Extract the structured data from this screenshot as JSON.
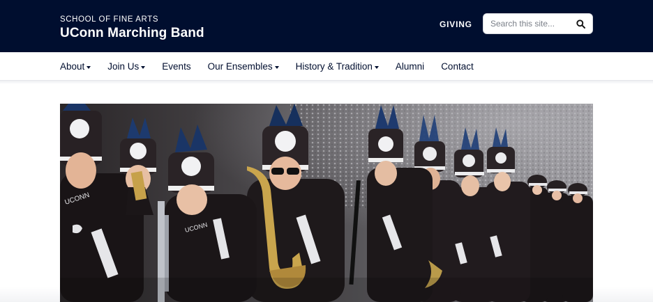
{
  "header": {
    "eyebrow": "SCHOOL OF FINE ARTS",
    "title": "UConn Marching Band",
    "giving_label": "GIVING",
    "search_placeholder": "Search this site...",
    "search_icon": "magnifier-icon",
    "background_color": "#000e2f"
  },
  "nav": {
    "items": [
      {
        "label": "About",
        "dropdown": true
      },
      {
        "label": "Join Us",
        "dropdown": true
      },
      {
        "label": "Events",
        "dropdown": false
      },
      {
        "label": "Our Ensembles",
        "dropdown": true
      },
      {
        "label": "History & Tradition",
        "dropdown": true
      },
      {
        "label": "Alumni",
        "dropdown": false
      },
      {
        "label": "Contact",
        "dropdown": false
      }
    ]
  },
  "hero": {
    "subject": "marching band members in dark uniforms with white-plumed shakos holding saxophones and clarinets in a stadium"
  }
}
